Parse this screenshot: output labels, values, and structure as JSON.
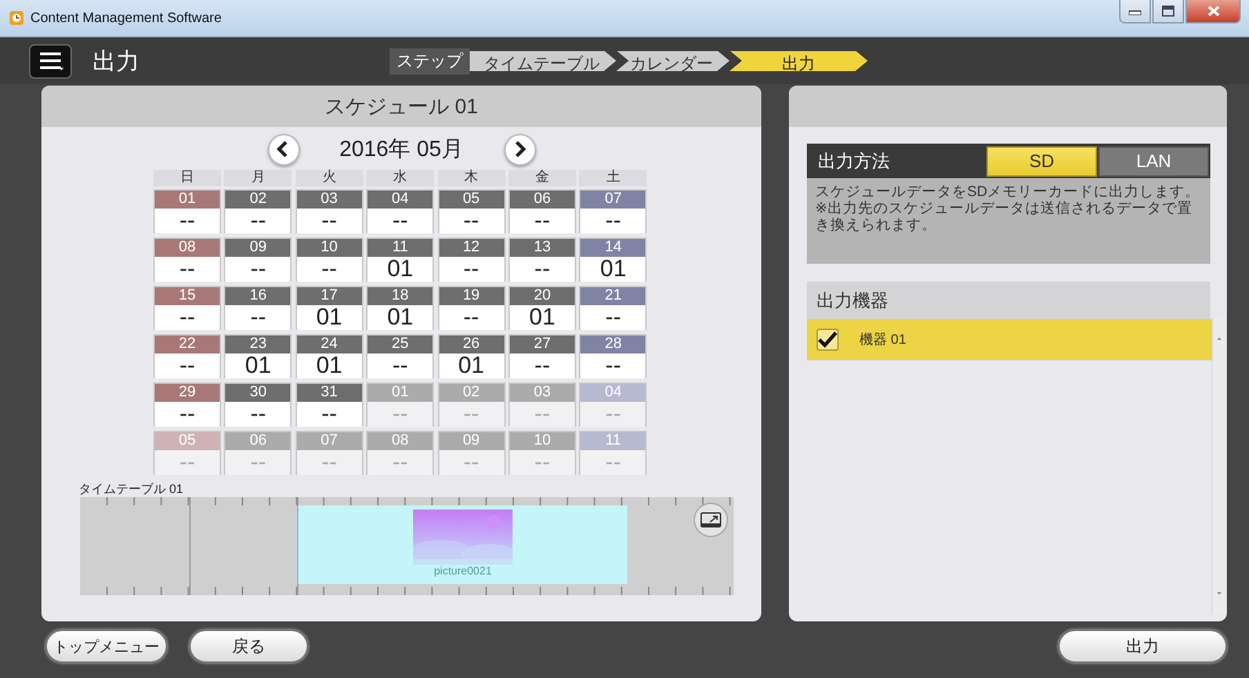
{
  "window": {
    "title": "Content Management Software"
  },
  "header": {
    "title": "出力",
    "steps_label": "ステップ",
    "steps": [
      {
        "label": "タイムテーブル",
        "selected": false
      },
      {
        "label": "カレンダー",
        "selected": false
      },
      {
        "label": "出力",
        "selected": true
      }
    ]
  },
  "schedule": {
    "title": "スケジュール 01",
    "month": "2016年 05月",
    "weekdays": [
      {
        "label": "日"
      },
      {
        "label": "月"
      },
      {
        "label": "火"
      },
      {
        "label": "水"
      },
      {
        "label": "木"
      },
      {
        "label": "金"
      },
      {
        "label": "土"
      }
    ],
    "weeks": [
      [
        {
          "day": "01",
          "kind": "sun",
          "current": true,
          "value": "--"
        },
        {
          "day": "02",
          "kind": "weekday",
          "current": true,
          "value": "--"
        },
        {
          "day": "03",
          "kind": "weekday",
          "current": true,
          "value": "--"
        },
        {
          "day": "04",
          "kind": "weekday",
          "current": true,
          "value": "--"
        },
        {
          "day": "05",
          "kind": "weekday",
          "current": true,
          "value": "--"
        },
        {
          "day": "06",
          "kind": "weekday",
          "current": true,
          "value": "--"
        },
        {
          "day": "07",
          "kind": "sat",
          "current": true,
          "value": "--"
        }
      ],
      [
        {
          "day": "08",
          "kind": "sun",
          "current": true,
          "value": "--"
        },
        {
          "day": "09",
          "kind": "weekday",
          "current": true,
          "value": "--"
        },
        {
          "day": "10",
          "kind": "weekday",
          "current": true,
          "value": "--"
        },
        {
          "day": "11",
          "kind": "weekday",
          "current": true,
          "value": "01"
        },
        {
          "day": "12",
          "kind": "weekday",
          "current": true,
          "value": "--"
        },
        {
          "day": "13",
          "kind": "weekday",
          "current": true,
          "value": "--"
        },
        {
          "day": "14",
          "kind": "sat",
          "current": true,
          "value": "01"
        }
      ],
      [
        {
          "day": "15",
          "kind": "sun",
          "current": true,
          "value": "--"
        },
        {
          "day": "16",
          "kind": "weekday",
          "current": true,
          "value": "--"
        },
        {
          "day": "17",
          "kind": "weekday",
          "current": true,
          "value": "01"
        },
        {
          "day": "18",
          "kind": "weekday",
          "current": true,
          "value": "01"
        },
        {
          "day": "19",
          "kind": "weekday",
          "current": true,
          "value": "--"
        },
        {
          "day": "20",
          "kind": "weekday",
          "current": true,
          "value": "01"
        },
        {
          "day": "21",
          "kind": "sat",
          "current": true,
          "value": "--"
        }
      ],
      [
        {
          "day": "22",
          "kind": "sun",
          "current": true,
          "value": "--"
        },
        {
          "day": "23",
          "kind": "weekday",
          "current": true,
          "value": "01"
        },
        {
          "day": "24",
          "kind": "weekday",
          "current": true,
          "value": "01"
        },
        {
          "day": "25",
          "kind": "weekday",
          "current": true,
          "value": "--"
        },
        {
          "day": "26",
          "kind": "weekday",
          "current": true,
          "value": "01"
        },
        {
          "day": "27",
          "kind": "weekday",
          "current": true,
          "value": "--"
        },
        {
          "day": "28",
          "kind": "sat",
          "current": true,
          "value": "--"
        }
      ],
      [
        {
          "day": "29",
          "kind": "sun",
          "current": true,
          "value": "--"
        },
        {
          "day": "30",
          "kind": "weekday",
          "current": true,
          "value": "--"
        },
        {
          "day": "31",
          "kind": "weekday",
          "current": true,
          "value": "--"
        },
        {
          "day": "01",
          "kind": "weekday",
          "current": false,
          "value": "--"
        },
        {
          "day": "02",
          "kind": "weekday",
          "current": false,
          "value": "--"
        },
        {
          "day": "03",
          "kind": "weekday",
          "current": false,
          "value": "--"
        },
        {
          "day": "04",
          "kind": "sat",
          "current": false,
          "value": "--"
        }
      ],
      [
        {
          "day": "05",
          "kind": "sun",
          "current": false,
          "value": "--"
        },
        {
          "day": "06",
          "kind": "weekday",
          "current": false,
          "value": "--"
        },
        {
          "day": "07",
          "kind": "weekday",
          "current": false,
          "value": "--"
        },
        {
          "day": "08",
          "kind": "weekday",
          "current": false,
          "value": "--"
        },
        {
          "day": "09",
          "kind": "weekday",
          "current": false,
          "value": "--"
        },
        {
          "day": "10",
          "kind": "weekday",
          "current": false,
          "value": "--"
        },
        {
          "day": "11",
          "kind": "sat",
          "current": false,
          "value": "--"
        }
      ]
    ],
    "timetable": {
      "label": "タイムテーブル 01",
      "clip": {
        "kind": "picture",
        "name": "picture0021"
      }
    }
  },
  "output": {
    "method_label": "出力方法",
    "methods": [
      {
        "label": "SD",
        "selected": true
      },
      {
        "label": "LAN",
        "selected": false
      }
    ],
    "description": "スケジュールデータをSDメモリーカードに出力します。\n※出力先のスケジュールデータは送信されるデータで置き換えられます。",
    "devices_label": "出力機器",
    "devices": [
      {
        "name": "機器 01",
        "checked": true,
        "selected": true
      }
    ]
  },
  "footer": {
    "left_buttons": [
      {
        "label": "トップメニュー"
      },
      {
        "label": "戻る"
      }
    ],
    "right_button": {
      "label": "出力"
    }
  }
}
